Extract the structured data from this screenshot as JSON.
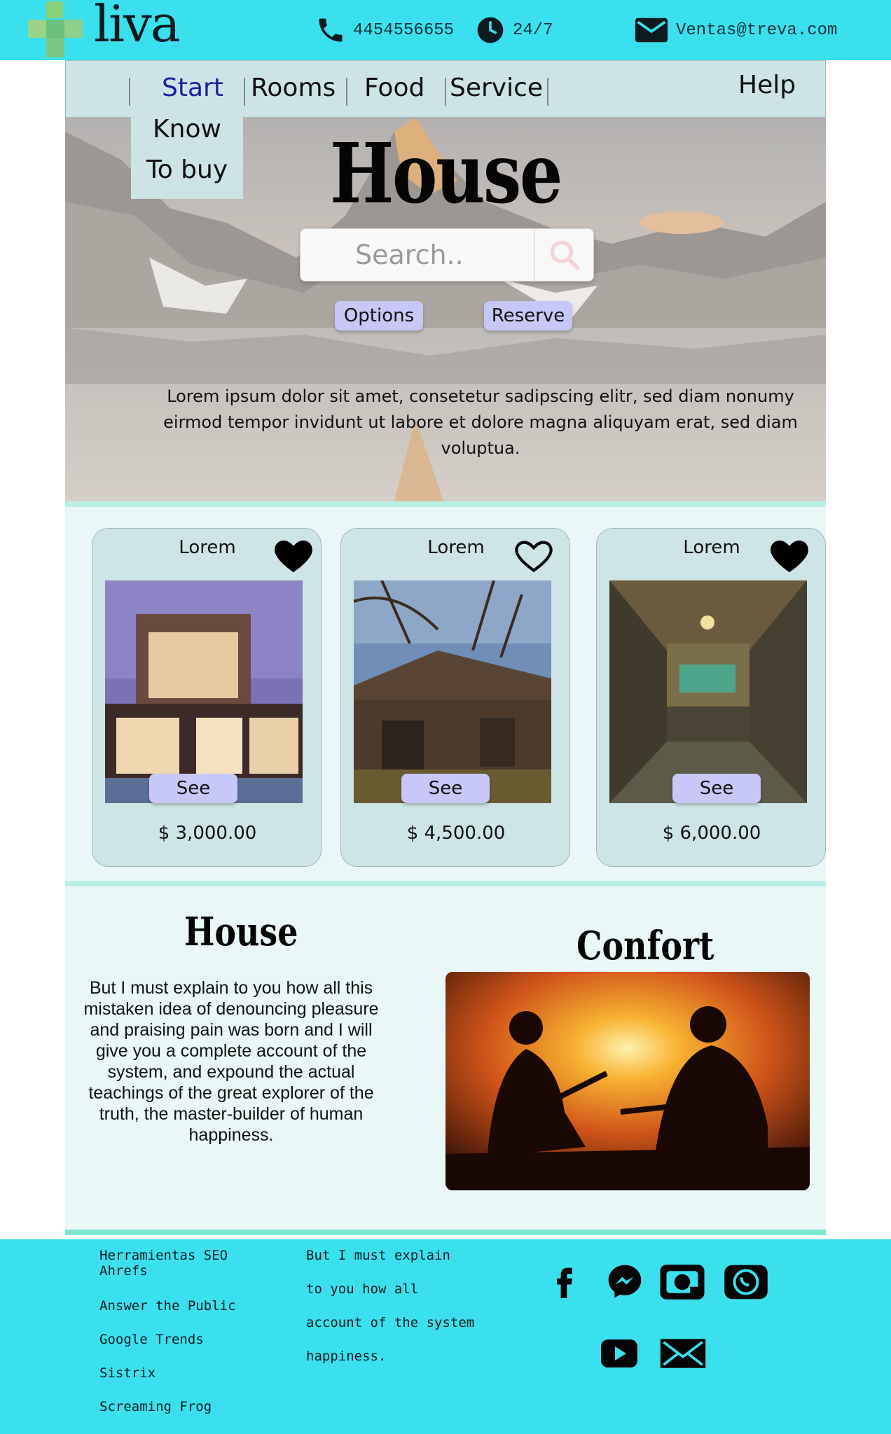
{
  "brand": {
    "logo_text": "liva"
  },
  "contacts": {
    "phone": "4454556655",
    "hours": "24/7",
    "email": "Ventas@treva.com"
  },
  "nav": {
    "items": [
      "Start",
      "Rooms",
      "Food",
      "Service"
    ],
    "active": "Start",
    "active_color": "#1b1f9e",
    "help": "Help",
    "dropdown": [
      "Know",
      "To buy"
    ]
  },
  "hero": {
    "title": "House",
    "search_placeholder": "Search..",
    "buttons": [
      "Options",
      "Reserve"
    ],
    "text": "Lorem ipsum dolor sit amet, consetetur  sadipscing elitr, sed diam nonumy eirmod tempor invidunt ut labore et dolore magna  aliquyam erat, sed diam voluptua."
  },
  "cards": [
    {
      "title": "Lorem",
      "price": "$ 3,000.00",
      "button": "See",
      "favorite": true
    },
    {
      "title": "Lorem",
      "price": "$ 4,500.00",
      "button": "See",
      "favorite": false
    },
    {
      "title": "Lorem",
      "price": "$ 6,000.00",
      "button": "See",
      "favorite": true
    }
  ],
  "features": {
    "left_title": "House",
    "left_text": "But I must explain to you how all this mistaken idea of denouncing pleasure and praising pain was born and I will give you a complete account of the system, and expound the actual teachings of the great explorer of the truth, the master-builder of human happiness.",
    "right_title": "Confort"
  },
  "footer": {
    "links": [
      "Herramientas SEO Ahrefs",
      "Answer the Public",
      "Google Trends",
      "Sistrix",
      "Screaming Frog"
    ],
    "text_lines": [
      "But I must explain",
      "to you how all",
      "account of the system",
      "happiness."
    ],
    "social": [
      "facebook-icon",
      "messenger-icon",
      "instagram-icon",
      "whatsapp-icon",
      "youtube-icon",
      "mail-icon"
    ]
  },
  "colors": {
    "topbar": "#3ae0ee",
    "nav": "#cce4e6",
    "pill": "#c7c8f8",
    "section": "#e9f7f7"
  }
}
